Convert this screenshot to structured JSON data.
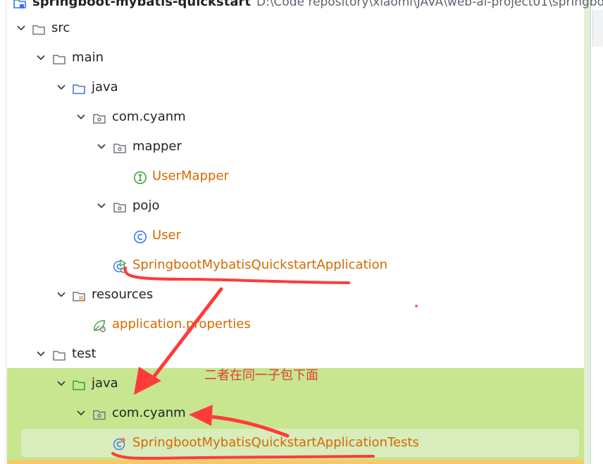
{
  "project": {
    "name": "springboot-mybatis-quickstart",
    "path": "D:\\Code repository\\xiaomi\\JAVA\\web-ai-project01\\springboot"
  },
  "tree": {
    "src": "src",
    "main": "main",
    "main_java": "java",
    "main_pkg": "com.cyanm",
    "mapper": "mapper",
    "user_mapper": "UserMapper",
    "pojo": "pojo",
    "user": "User",
    "app": "SpringbootMybatisQuickstartApplication",
    "resources": "resources",
    "properties": "application.properties",
    "test": "test",
    "test_java": "java",
    "test_pkg": "com.cyanm",
    "app_tests": "SpringbootMybatisQuickstartApplicationTests"
  },
  "annotation": {
    "text": "二者在同一子包下面",
    "color": "#e23b3b"
  },
  "colors": {
    "folder": "#6e7781",
    "source_folder": "#3574f0",
    "test_folder": "#3b9c3b",
    "class_label": "#d06b00",
    "interface_icon": "#3b9c3b",
    "class_icon": "#3574f0",
    "highlight_band": "#c7e68f"
  }
}
